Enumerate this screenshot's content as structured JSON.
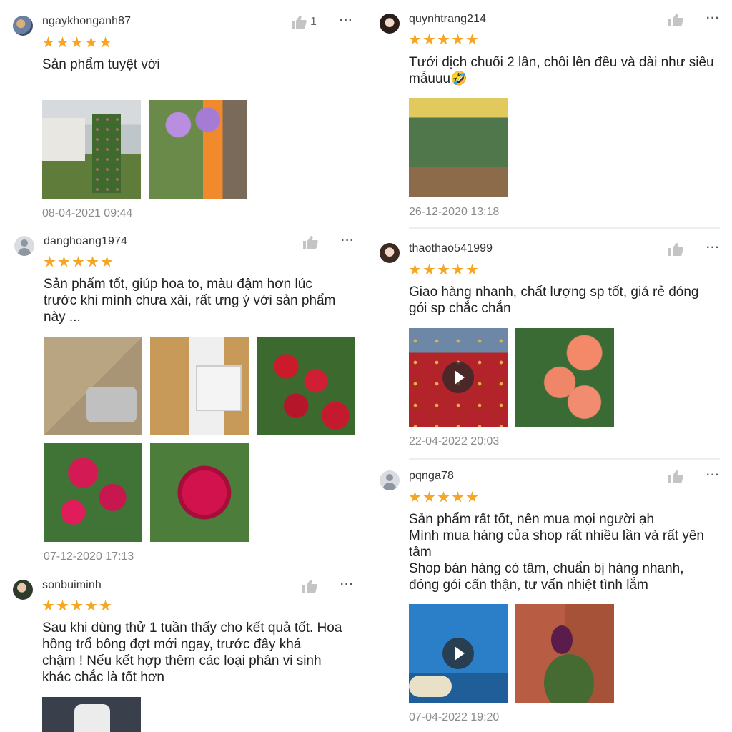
{
  "reviews": [
    {
      "username": "ngaykhonganh87",
      "text": "Sản phẩm tuyệt vời",
      "time": "08-04-2021 09:44",
      "like_count": "1",
      "more": "···",
      "photos": [
        "rose-garden-photo",
        "lilac-rose-child-photo"
      ]
    },
    {
      "username": "danghoang1974",
      "text_lines": [
        "Sản phẩm tốt, giúp hoa to, màu đậm hơn lúc",
        "trước khi mình chưa xài, rất ưng ý với sản phẩm",
        "này ..."
      ],
      "time": "07-12-2020 17:13",
      "more": "···",
      "photos": [
        "package-photo",
        "bottle-photo",
        "red-roses-photo",
        "red-roses-photo-2",
        "red-rose-closeup-photo"
      ]
    },
    {
      "username": "sonbuiminh",
      "text_lines": [
        "Sau khi dùng thử 1 tuần thấy cho kết quả tốt. Hoa",
        "hồng trổ bông đợt mới ngay, trước đây khá",
        "chậm ! Nếu kết hợp thêm các loại phân vi sinh",
        "khác chắc là tốt hơn"
      ],
      "more": "···",
      "photos": [
        "product-bottle-photo"
      ]
    },
    {
      "username": "quynhtrang214",
      "text_lines": [
        "Tưới dịch chuối 2 lần, chồi lên đều và dài như siêu",
        "mẫuuu🤣"
      ],
      "time": "26-12-2020 13:18",
      "more": "···",
      "photos": [
        "garden-railing-photo"
      ]
    },
    {
      "username": "thaothao541999",
      "text_lines": [
        "Giao hàng nhanh, chất lượng sp tốt, giá rẻ đóng",
        "gói sp chắc chắn"
      ],
      "time": "22-04-2022 20:03",
      "more": "···",
      "photos": [
        "carpet-video",
        "orange-roses-photo"
      ]
    },
    {
      "username": "pqnga78",
      "text_lines": [
        "Sản phẩm rất tốt, nên mua mọi người ạh",
        "Mình mua hàng của shop rất nhiều lần và rất yên",
        "tâm",
        "Shop bán hàng có tâm, chuẩn bị hàng nhanh,",
        "đóng gói cẩn thận, tư vấn nhiệt tình lắm"
      ],
      "time": "07-04-2022 19:20",
      "more": "···",
      "photos": [
        "blue-video",
        "rose-bud-photo"
      ]
    }
  ],
  "colors": {
    "star": "#f6a623",
    "time": "#8b8b8b",
    "username": "#333333"
  },
  "icons": {
    "like": "thumbs-up-icon",
    "more": "more-icon",
    "star": "star-icon",
    "play": "play-icon"
  }
}
